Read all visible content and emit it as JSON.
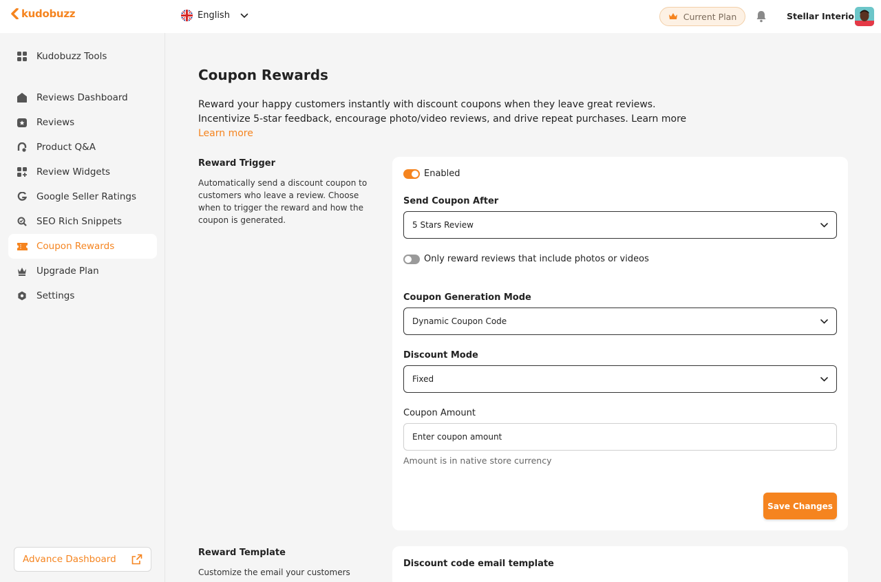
{
  "brand": {
    "name": "kudobuzz",
    "accent": "#f5841f"
  },
  "header": {
    "language": "English",
    "plan_label": "Current Plan",
    "store_name": "Stellar Interiors"
  },
  "sidebar": {
    "tools_label": "Kudobuzz Tools",
    "items": [
      {
        "label": "Reviews Dashboard",
        "icon": "home-icon"
      },
      {
        "label": "Reviews",
        "icon": "reviews-icon"
      },
      {
        "label": "Product Q&A",
        "icon": "qa-icon"
      },
      {
        "label": "Review Widgets",
        "icon": "widgets-icon"
      },
      {
        "label": "Google Seller Ratings",
        "icon": "google-icon"
      },
      {
        "label": "SEO Rich Snippets",
        "icon": "seo-icon"
      },
      {
        "label": "Coupon Rewards",
        "icon": "ticket-icon",
        "active": true
      },
      {
        "label": "Upgrade Plan",
        "icon": "crown-icon"
      },
      {
        "label": "Settings",
        "icon": "settings-icon"
      }
    ],
    "advance_dashboard_label": "Advance Dashboard"
  },
  "main": {
    "title": "Coupon Rewards",
    "description_line1": "Reward your happy customers instantly with discount coupons when they leave great reviews.",
    "description_line2": "Incentivize 5-star feedback, encourage photo/video reviews, and drive repeat purchases. Learn more",
    "learn_more": "Learn more",
    "reward_trigger": {
      "title": "Reward Trigger",
      "description": "Automatically send a discount coupon to customers who leave a review. Choose when to trigger the reward and how the coupon is generated.",
      "enabled_label": "Enabled",
      "enabled": true,
      "send_after_label": "Send Coupon After",
      "send_after_value": "5 Stars Review",
      "media_only_label": "Only reward reviews that include photos or videos",
      "media_only": false,
      "generation_mode_label": "Coupon Generation Mode",
      "generation_mode_value": "Dynamic Coupon Code",
      "discount_mode_label": "Discount Mode",
      "discount_mode_value": "Fixed",
      "amount_label": "Coupon Amount",
      "amount_placeholder": "Enter coupon amount",
      "amount_hint": "Amount is in native store currency",
      "save_label": "Save Changes"
    },
    "reward_template": {
      "title": "Reward Template",
      "description": "Customize the email your customers",
      "card_title": "Discount code email template"
    }
  }
}
